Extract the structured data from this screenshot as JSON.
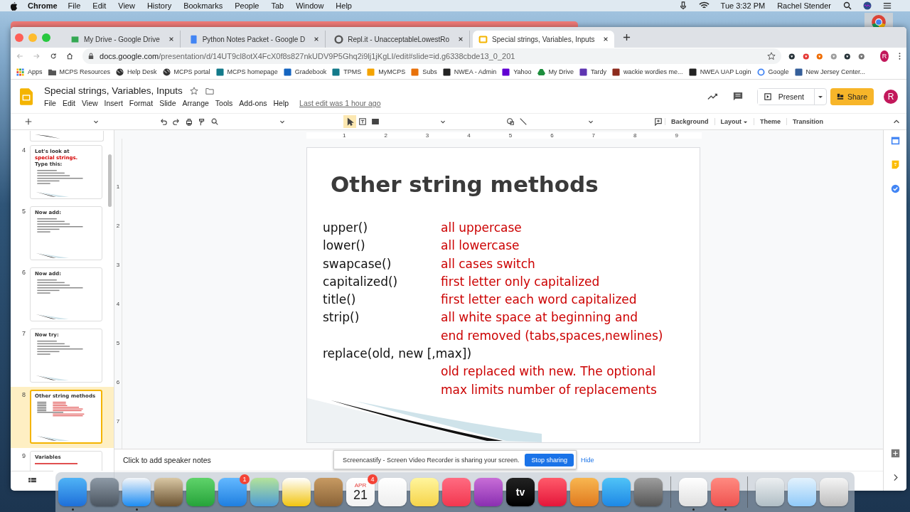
{
  "menubar": {
    "app": "Chrome",
    "menus": [
      "File",
      "Edit",
      "View",
      "History",
      "Bookmarks",
      "People",
      "Tab",
      "Window",
      "Help"
    ],
    "clock": "Tue 3:32 PM",
    "user": "Rachel Stender"
  },
  "tabs": [
    {
      "title": "My Drive - Google Drive",
      "selected": false
    },
    {
      "title": "Python Notes Packet - Google D",
      "selected": false
    },
    {
      "title": "Repl.it - UnacceptableLowestRo",
      "selected": false
    },
    {
      "title": "Special strings, Variables, Inputs",
      "selected": true
    }
  ],
  "url": {
    "host": "docs.google.com",
    "path": "/presentation/d/14UT9cl8otX4FcX0f8s827nkUDV9P5Ghq2i9lj1jKgLI/edit#slide=id.g6338cbde13_0_201"
  },
  "profile": "R",
  "bookmarks": [
    "Apps",
    "MCPS Resources",
    "Help Desk",
    "MCPS portal",
    "MCPS homepage",
    "Gradebook",
    "TPMS",
    "MyMCPS",
    "Subs",
    "NWEA - Admin",
    "Yahoo",
    "My Drive",
    "Tardy",
    "wackie wordies me...",
    "NWEA UAP Login",
    "Google",
    "New Jersey Center..."
  ],
  "doc": {
    "title": "Special strings, Variables, Inputs",
    "menus": [
      "File",
      "Edit",
      "View",
      "Insert",
      "Format",
      "Slide",
      "Arrange",
      "Tools",
      "Add-ons",
      "Help"
    ],
    "last_edit": "Last edit was 1 hour ago",
    "present": "Present",
    "share": "Share",
    "avatar": "R"
  },
  "toolbar": {
    "buttons": [
      "Background",
      "Layout",
      "Theme",
      "Transition"
    ]
  },
  "ruler": {
    "horizontal": [
      "1",
      "2",
      "3",
      "4",
      "5",
      "6",
      "7",
      "8",
      "9"
    ],
    "vertical": [
      "1",
      "2",
      "3",
      "4",
      "5",
      "6",
      "7"
    ]
  },
  "thumbnails": [
    {
      "number": "4",
      "kind": "code",
      "selected": false,
      "title_parts": [
        {
          "text": "Let's look at",
          "highlight": false
        },
        {
          "text": "special strings.",
          "highlight": true
        },
        {
          "text": "Type this:",
          "highlight": false
        }
      ]
    },
    {
      "number": "5",
      "kind": "code",
      "selected": false,
      "title_parts": [
        {
          "text": "Now add:",
          "highlight": false
        }
      ]
    },
    {
      "number": "6",
      "kind": "code",
      "selected": false,
      "title_parts": [
        {
          "text": "Now add:",
          "highlight": false
        }
      ]
    },
    {
      "number": "7",
      "kind": "code",
      "selected": false,
      "title_parts": [
        {
          "text": "Now try:",
          "highlight": false
        }
      ]
    },
    {
      "number": "8",
      "kind": "methods",
      "selected": true,
      "title_parts": [
        {
          "text": "Other string methods",
          "highlight": false
        }
      ]
    },
    {
      "number": "9",
      "kind": "subtitle",
      "selected": false,
      "title_parts": [
        {
          "text": "Variables",
          "highlight": false
        }
      ]
    }
  ],
  "slide": {
    "title": "Other string methods",
    "rows": [
      {
        "method": "upper()",
        "description": "all uppercase"
      },
      {
        "method": "lower()",
        "description": "all lowercase"
      },
      {
        "method": "swapcase()",
        "description": "all cases switch"
      },
      {
        "method": "capitalized()",
        "description": "first letter only capitalized"
      },
      {
        "method": "title()",
        "description": "first letter each word capitalized"
      },
      {
        "method": "strip()",
        "description": "all white space at beginning and"
      },
      {
        "description": "end removed (tabs,spaces,newlines)"
      },
      {
        "method": "replace(old, new [,max])"
      },
      {
        "description": "old replaced with new.  The optional"
      },
      {
        "description": "max limits number of replacements"
      }
    ]
  },
  "speaker_notes": {
    "placeholder": "Click to add speaker notes"
  },
  "screencastify": {
    "message": "Screencastify - Screen Video Recorder is sharing your screen.",
    "stop": "Stop sharing",
    "hide": "Hide"
  },
  "dock": {
    "sections": [
      {
        "apps": [
          {
            "running": true
          },
          {
            "running": false
          },
          {
            "running": true
          },
          {
            "running": false
          },
          {
            "running": false
          },
          {
            "running": false,
            "badge": "1"
          },
          {
            "running": false
          },
          {
            "running": false
          },
          {
            "running": false
          },
          {
            "running": false,
            "badge": "4",
            "month": "APR",
            "day": "21"
          },
          {
            "running": false
          },
          {
            "running": false
          },
          {
            "running": false
          },
          {
            "running": false
          },
          {
            "running": false,
            "label": "tv"
          },
          {
            "running": false
          },
          {
            "running": false
          },
          {
            "running": false
          },
          {
            "running": false
          }
        ]
      },
      {
        "apps": [
          {
            "running": true
          },
          {
            "running": true
          }
        ]
      },
      {
        "apps": [
          {
            "running": false
          },
          {
            "running": false
          },
          {
            "running": false
          }
        ]
      }
    ]
  }
}
